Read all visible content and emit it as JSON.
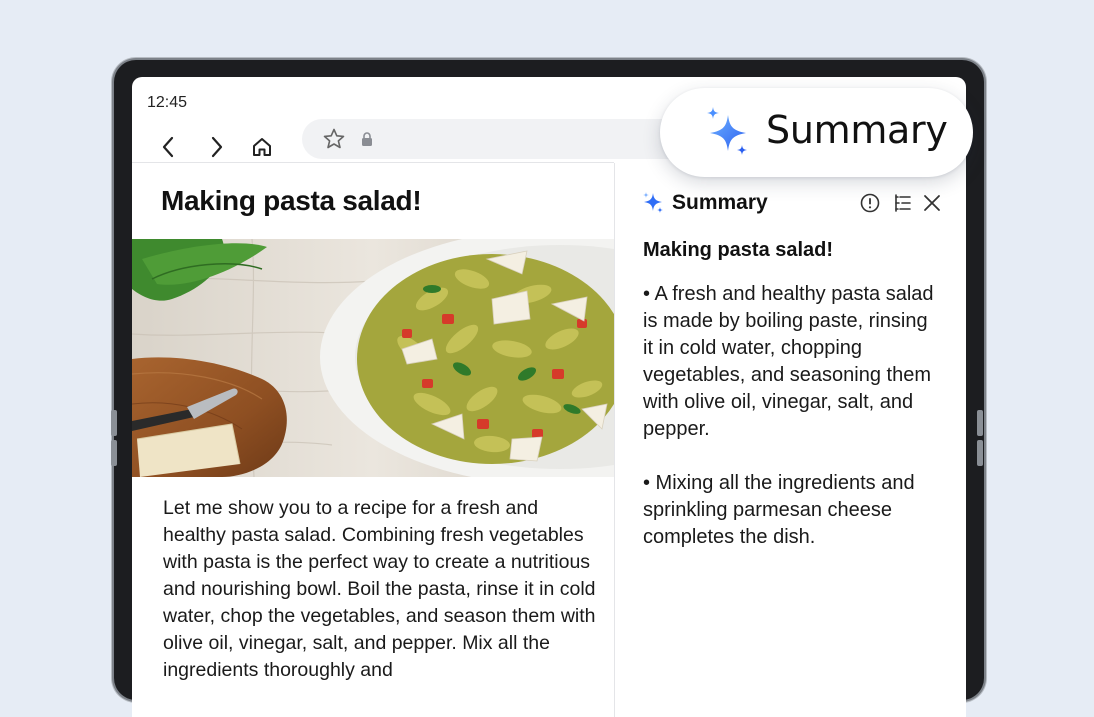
{
  "status": {
    "time": "12:45"
  },
  "article": {
    "title": "Making pasta salad!",
    "hero_alt": "Pasta salad with vegetables and parmesan",
    "body": "Let me show you to a recipe for a fresh and healthy pasta salad. Combining fresh vegetables with pasta is the perfect way to create a nutritious and nourishing bowl. Boil the pasta, rinse it in cold water, chop the vegetables, and season them with olive oil, vinegar, salt, and pepper. Mix all the ingredients thoroughly and"
  },
  "summary_panel": {
    "title": "Summary",
    "heading": "Making pasta salad!",
    "points": [
      "• A fresh and healthy pasta salad is made by boiling paste, rinsing it in cold water, chopping vegetables, and seasoning them with olive oil, vinegar, salt, and pepper.",
      "• Mixing all the ingredients and sprinkling parmesan cheese completes the dish."
    ]
  },
  "summary_pill": {
    "label": "Summary"
  },
  "colors": {
    "accent": "#2f6df6",
    "sparkle_light": "#7fb2ff"
  }
}
